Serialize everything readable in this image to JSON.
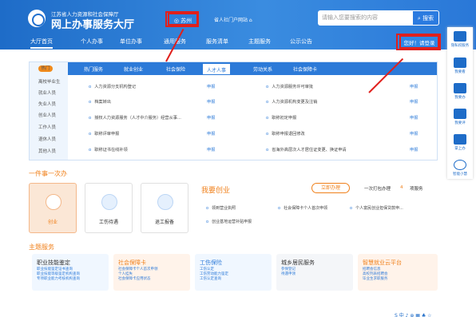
{
  "header": {
    "sub": "江苏省人力资源和社会保障厅",
    "title": "网上办事服务大厅",
    "city": "苏州",
    "prov": "省人社门户网站 ⌂",
    "search_placeholder": "请输入您要搜索的内容",
    "search_btn": "搜索"
  },
  "nav": [
    "大厅首页",
    "个人办事",
    "单位办事",
    "通用服务",
    "服务清单",
    "主题服务",
    "公示公告"
  ],
  "login": "您好！请登录",
  "side": [
    "隐私权服务",
    "我要看",
    "我要办",
    "我要评",
    "掌上办",
    "智能小慧"
  ],
  "cats": [
    "热门",
    "离校毕业生",
    "就业人员",
    "失业人员",
    "创业人员",
    "工作人员",
    "退休人员",
    "其他人员"
  ],
  "tabs": [
    "热门服务",
    "就业创业",
    "社会保险",
    "人才人事",
    "劳动关系",
    "社会保障卡"
  ],
  "rows_left": [
    "人力资源分支机构登记",
    "档案转出",
    "授权人力资源服务（人才中介服务）经营从事...",
    "职称评审申报",
    "职称证书在线补领"
  ],
  "rows_right": [
    "人力资源服务许可审批",
    "人力资源机构变更及注销",
    "职称初定申报",
    "职称申报退回修改",
    "省海外高层次人才居住证变更、换证申请"
  ],
  "apply": "申报",
  "sec1": "一件事一次办",
  "cards": [
    "创业",
    "工伤待遇",
    "退工报备"
  ],
  "detail": {
    "title": "我要创业",
    "btn": "立即办理",
    "onego": "一次打包办理",
    "count": "4",
    "count_unit": "项服务",
    "items": [
      "领到营业执照",
      "社会保障卡个人首次申领",
      "个人富民创业担保贷款申...",
      "创业基地运营补贴申报"
    ]
  },
  "sec2": "主题服务",
  "svc": [
    {
      "t": "职业技能鉴定",
      "d": "职业技能鉴定证书查询\n职业技能等级鉴定机构查询\n专项职业能力考核机构查询"
    },
    {
      "t": "社会保障卡",
      "d": "社会保障卡个人首次申领\n个人挂失\n社会保障卡应用状态"
    },
    {
      "t": "工伤保险",
      "d": "工伤认定\n工伤劳动能力鉴定\n工伤认定查询"
    },
    {
      "t": "城乡居民服务",
      "d": "参保登记\n待遇申领"
    },
    {
      "t": "智慧就业云平台",
      "d": "招聘会信息\n高校列表招聘会\n毕业生求职服务"
    }
  ],
  "tray": "S 中 ♪ ⊕ ▦ ♣ ☆"
}
